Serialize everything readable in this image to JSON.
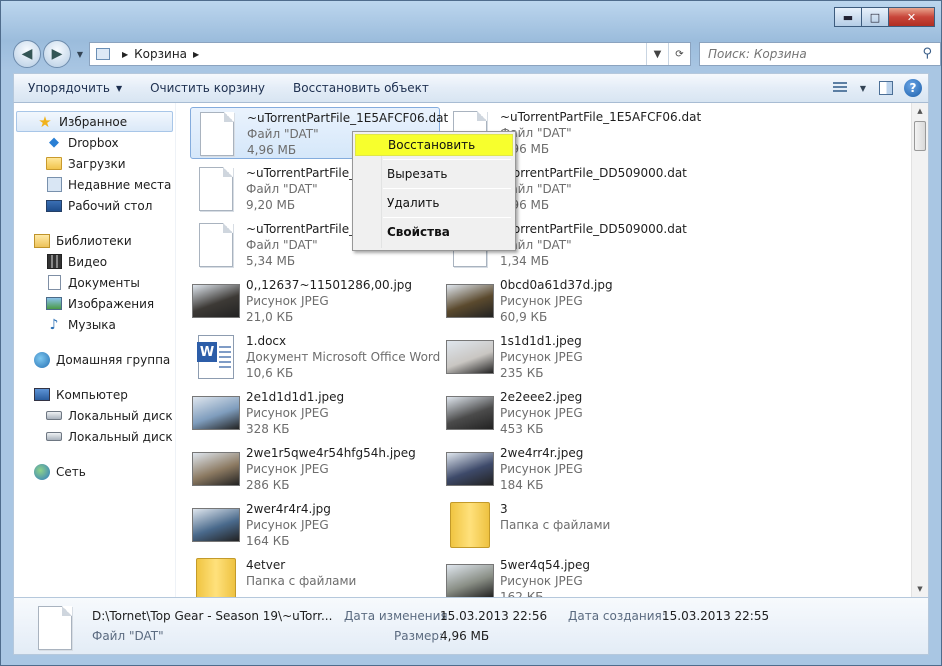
{
  "window": {
    "caption_buttons": {
      "minimize": "▬",
      "maximize": "□",
      "close": "✕"
    },
    "breadcrumb": "Корзина",
    "search_placeholder": "Поиск: Корзина"
  },
  "toolbar": {
    "organize": "Упорядочить",
    "empty_bin": "Очистить корзину",
    "restore": "Восстановить объект",
    "help": "?"
  },
  "sidebar": {
    "favorites": {
      "label": "Избранное",
      "items": [
        "Dropbox",
        "Загрузки",
        "Недавние места",
        "Рабочий стол"
      ]
    },
    "libraries": {
      "label": "Библиотеки",
      "items": [
        "Видео",
        "Документы",
        "Изображения",
        "Музыка"
      ]
    },
    "homegroup": "Домашняя группа",
    "computer": {
      "label": "Компьютер",
      "items": [
        "Локальный диск (C",
        "Локальный диск (D"
      ]
    },
    "network": "Сеть"
  },
  "files": [
    {
      "name": "~uTorrentPartFile_1E5AFCF06.dat",
      "type": "Файл \"DAT\"",
      "size": "4,96 МБ",
      "kind": "file",
      "selected": true
    },
    {
      "name": "~uTorrentPartFile_1E5AFCF06.dat",
      "type": "Файл \"DAT\"",
      "size": "4,96 МБ",
      "kind": "file"
    },
    {
      "name": "~uTorrentPartFile_1E",
      "type": "Файл \"DAT\"",
      "size": "9,20 МБ",
      "kind": "file"
    },
    {
      "name": "uTorrentPartFile_DD509000.dat",
      "type": "Файл \"DAT\"",
      "size": "4,96 МБ",
      "kind": "file"
    },
    {
      "name": "~uTorrentPartFile_D",
      "type": "Файл \"DAT\"",
      "size": "5,34 МБ",
      "kind": "file"
    },
    {
      "name": "uTorrentPartFile_DD509000.dat",
      "type": "Файл \"DAT\"",
      "size": "1,34 МБ",
      "kind": "file"
    },
    {
      "name": "0,,12637~11501286,00.jpg",
      "type": "Рисунок JPEG",
      "size": "21,0 КБ",
      "kind": "photo",
      "color": "#3d3a36"
    },
    {
      "name": "0bcd0a61d37d.jpg",
      "type": "Рисунок JPEG",
      "size": "60,9 КБ",
      "kind": "photo",
      "color": "#5b4a2e"
    },
    {
      "name": "1.docx",
      "type": "Документ Microsoft Office Word",
      "size": "10,6 КБ",
      "kind": "word"
    },
    {
      "name": "1s1d1d1.jpeg",
      "type": "Рисунок JPEG",
      "size": "235 КБ",
      "kind": "photo",
      "color": "#c9c6c2"
    },
    {
      "name": "2e1d1d1d1.jpeg",
      "type": "Рисунок JPEG",
      "size": "328 КБ",
      "kind": "photo",
      "color": "#7f9dbd"
    },
    {
      "name": "2e2eee2.jpeg",
      "type": "Рисунок JPEG",
      "size": "453 КБ",
      "kind": "photo",
      "color": "#4b4b4b"
    },
    {
      "name": "2we1r5qwe4r54hfg54h.jpeg",
      "type": "Рисунок JPEG",
      "size": "286 КБ",
      "kind": "photo",
      "color": "#8c7a62"
    },
    {
      "name": "2we4rr4r.jpeg",
      "type": "Рисунок JPEG",
      "size": "184 КБ",
      "kind": "photo",
      "color": "#3e4a6a"
    },
    {
      "name": "2wer4r4r4.jpg",
      "type": "Рисунок JPEG",
      "size": "164 КБ",
      "kind": "photo",
      "color": "#4a6a8c"
    },
    {
      "name": "3",
      "type": "Папка с файлами",
      "size": "",
      "kind": "folder"
    },
    {
      "name": "4etver",
      "type": "Папка с файлами",
      "size": "",
      "kind": "folder"
    },
    {
      "name": "5wer4q54.jpeg",
      "type": "Рисунок JPEG",
      "size": "162 КБ",
      "kind": "photo",
      "color": "#8a8f86"
    }
  ],
  "context_menu": {
    "restore": "Восстановить",
    "cut": "Вырезать",
    "delete": "Удалить",
    "properties": "Свойства"
  },
  "details": {
    "path": "D:\\Tornet\\Top Gear - Season 19\\~uTorr...",
    "type": "Файл \"DAT\"",
    "modified_label": "Дата изменения:",
    "modified_value": "15.03.2013 22:56",
    "created_label": "Дата создания:",
    "created_value": "15.03.2013 22:55",
    "size_label": "Размер:",
    "size_value": "4,96 МБ"
  }
}
